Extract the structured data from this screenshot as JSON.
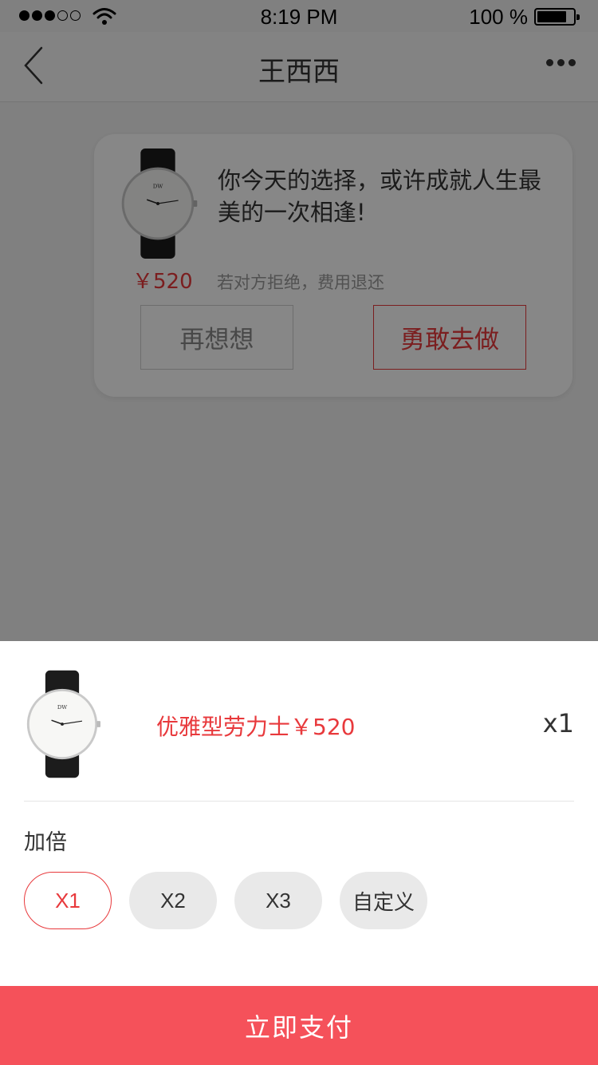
{
  "status_bar": {
    "time": "8:19 PM",
    "battery": "100 %",
    "signal_level": 3,
    "signal_total": 5,
    "battery_fill": 0.8,
    "icons": {
      "wifi": "wifi-icon",
      "battery": "battery-icon",
      "signal": "signal-dots-icon"
    }
  },
  "navbar": {
    "title": "王西西",
    "icons": {
      "back": "chevron-left-icon",
      "more": "more-dots-icon"
    }
  },
  "gift_card": {
    "price": "￥520",
    "message": "你今天的选择，或许成就人生最美的一次相逢!",
    "note": "若对方拒绝，费用退还",
    "think_button": "再想想",
    "go_button": "勇敢去做",
    "image": "watch-image"
  },
  "purchase_sheet": {
    "product": "优雅型劳力士￥520",
    "quantity": "x1",
    "multiplier_label": "加倍",
    "options": [
      "X1",
      "X2",
      "X3",
      "自定义"
    ],
    "selected_option": "X1",
    "pay_button": "立即支付",
    "image": "watch-image"
  },
  "colors": {
    "accent": "#e8393c",
    "pay_button": "#f5515a",
    "overlay": "rgba(0,0,0,0.47)"
  }
}
